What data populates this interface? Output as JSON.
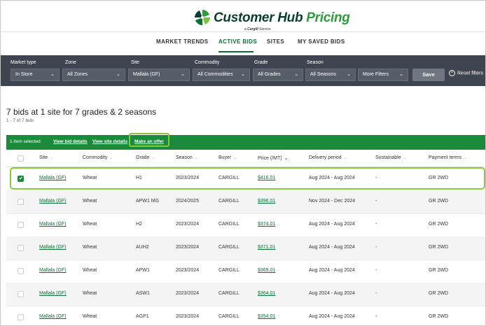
{
  "brand": {
    "title_part1": "Customer Hub ",
    "title_part2": "Pricing",
    "byline": "a",
    "byline_brand": "Cargill",
    "byline_suffix": "Service",
    "colors": {
      "dark_green": "#0b3d2e",
      "green": "#2e9b3e",
      "accent": "#1a8a3c",
      "highlight": "#8cc63f"
    }
  },
  "nav": {
    "tabs": [
      "MARKET TRENDS",
      "ACTIVE BIDS",
      "SITES",
      "MY SAVED BIDS"
    ],
    "active": "ACTIVE BIDS"
  },
  "filters": {
    "market_type": {
      "label": "Market type",
      "value": "In Store"
    },
    "zone": {
      "label": "Zone",
      "value": "All Zones"
    },
    "site": {
      "label": "Site",
      "value": "Mallala (GF)"
    },
    "commodity": {
      "label": "Commodity",
      "value": "All Commodities"
    },
    "grade": {
      "label": "Grade",
      "value": "All Grades"
    },
    "season": {
      "label": "Season",
      "value": "All Seasons"
    },
    "more": "More Filters",
    "save": "Save",
    "reset": "Reset filters"
  },
  "summary": {
    "title": "7 bids at 1 site for 7 grades & 2 seasons",
    "count": "1 - 7 of 7 bids"
  },
  "selection": {
    "selected_text": "1 item selected",
    "view_bid": "View bid details",
    "view_site": "View site details",
    "offer": "Make an offer"
  },
  "table": {
    "headers": [
      "Site",
      "Commodity",
      "Grade",
      "Season",
      "Buyer",
      "Price (/MT)",
      "Delivery period",
      "Sustainable",
      "Payment terms"
    ],
    "sorted_column": "Price (/MT)",
    "rows": [
      {
        "selected": true,
        "site": "Mallala (GF)",
        "commodity": "Wheat",
        "grade": "H1",
        "season": "2023/2024",
        "buyer": "CARGILL",
        "price": "$416.01",
        "delivery": "Aug 2024 - Aug 2024",
        "sustainable": "-",
        "payment": "GR 2WD"
      },
      {
        "selected": false,
        "site": "Mallala (GF)",
        "commodity": "Wheat",
        "grade": "APW1 MG",
        "season": "2024/2025",
        "buyer": "CARGILL",
        "price": "$396.01",
        "delivery": "Nov 2024 - Dec 2024",
        "sustainable": "-",
        "payment": "GR 2WD"
      },
      {
        "selected": false,
        "site": "Mallala (GF)",
        "commodity": "Wheat",
        "grade": "H2",
        "season": "2023/2024",
        "buyer": "CARGILL",
        "price": "$374.01",
        "delivery": "Aug 2024 - Aug 2024",
        "sustainable": "-",
        "payment": "GR 2WD"
      },
      {
        "selected": false,
        "site": "Mallala (GF)",
        "commodity": "Wheat",
        "grade": "AUH2",
        "season": "2023/2024",
        "buyer": "CARGILL",
        "price": "$371.01",
        "delivery": "Aug 2024 - Aug 2024",
        "sustainable": "-",
        "payment": "GR 2WD"
      },
      {
        "selected": false,
        "site": "Mallala (GF)",
        "commodity": "Wheat",
        "grade": "APW1",
        "season": "2023/2024",
        "buyer": "CARGILL",
        "price": "$369.01",
        "delivery": "Aug 2024 - Aug 2024",
        "sustainable": "-",
        "payment": "GR 2WD"
      },
      {
        "selected": false,
        "site": "Mallala (GF)",
        "commodity": "Wheat",
        "grade": "ASW1",
        "season": "2023/2024",
        "buyer": "CARGILL",
        "price": "$364.01",
        "delivery": "Aug 2024 - Aug 2024",
        "sustainable": "-",
        "payment": "GR 2WD"
      },
      {
        "selected": false,
        "site": "Mallala (GF)",
        "commodity": "Wheat",
        "grade": "AGP1",
        "season": "2023/2024",
        "buyer": "CARGILL",
        "price": "$354.01",
        "delivery": "Aug 2024 - Aug 2024",
        "sustainable": "-",
        "payment": "GR 2WD"
      }
    ]
  }
}
